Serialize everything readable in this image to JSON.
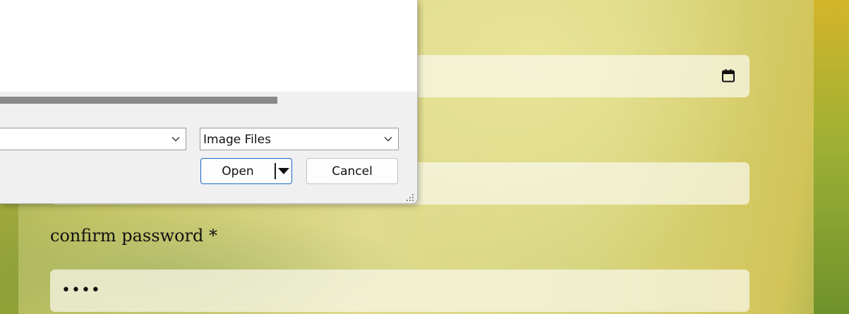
{
  "form": {
    "confirm_label": "confirm password *",
    "confirm_value": "••••"
  },
  "dialog": {
    "filetype_value": "Image Files",
    "open_label": "Open",
    "cancel_label": "Cancel"
  },
  "icons": {
    "calendar": "calendar-icon",
    "dropdown": "chevron-down-icon",
    "split_arrow": "caret-down-icon",
    "resize": "resize-grip-icon"
  },
  "colors": {
    "accent": "#1a66c6",
    "dialog_bg": "#f0f0f0"
  }
}
